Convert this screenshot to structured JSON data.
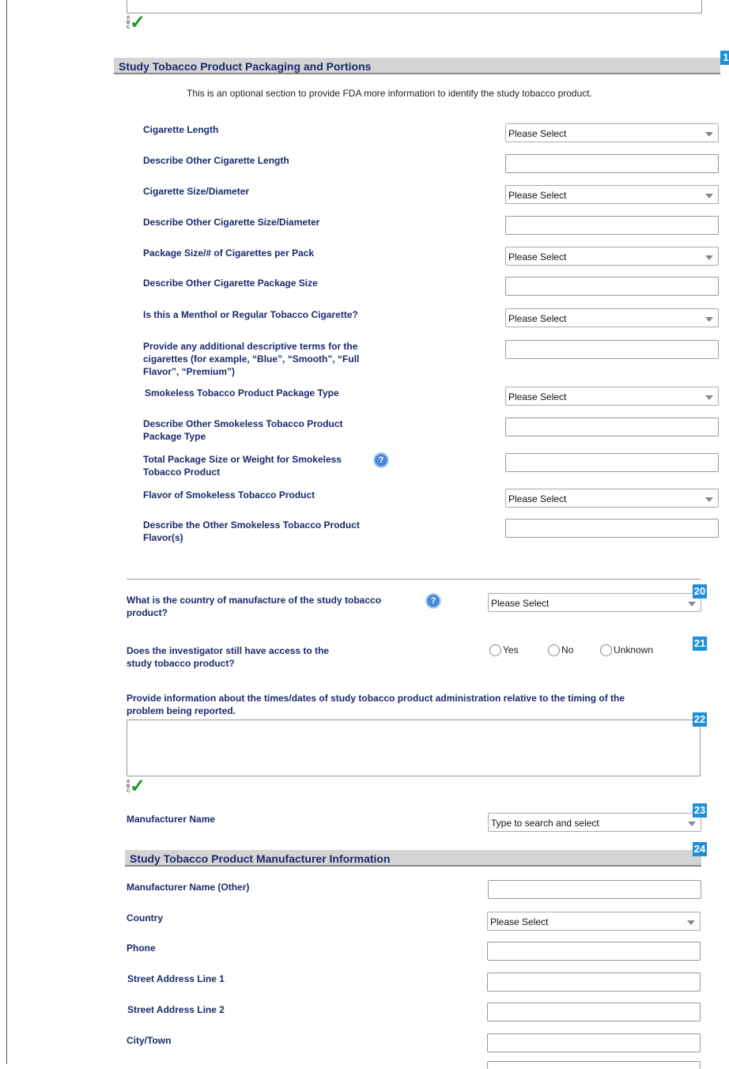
{
  "section1": {
    "title": "Study Tobacco Product Packaging and Portions",
    "number": "1",
    "intro": "This is an optional section to provide FDA more information to identify the study tobacco product."
  },
  "fields": {
    "cig_length": {
      "label": "Cigarette Length",
      "value": "Please Select"
    },
    "cig_length_other": {
      "label": "Describe Other Cigarette Length",
      "value": ""
    },
    "cig_size": {
      "label": "Cigarette Size/Diameter",
      "value": "Please Select"
    },
    "cig_size_other": {
      "label": "Describe Other Cigarette Size/Diameter",
      "value": ""
    },
    "pack_size": {
      "label": "Package Size/# of Cigarettes per Pack",
      "value": "Please Select"
    },
    "pack_size_other": {
      "label": "Describe Other Cigarette Package Size",
      "value": ""
    },
    "menthol": {
      "label": "Is this a Menthol or Regular Tobacco Cigarette?",
      "value": "Please Select"
    },
    "descriptive_terms": {
      "label_line1": "Provide any additional descriptive terms for the",
      "label_line2": "cigarettes (for example, “Blue”, “Smooth”, “Full",
      "label_line3": "Flavor”, “Premium”)",
      "value": ""
    },
    "smokeless_pkg": {
      "label": "Smokeless Tobacco Product Package Type",
      "value": "Please Select"
    },
    "smokeless_pkg_other": {
      "label_line1": "Describe Other Smokeless Tobacco Product",
      "label_line2": "Package Type",
      "value": ""
    },
    "smokeless_weight": {
      "label_line1": "Total Package Size or Weight for Smokeless",
      "label_line2": "Tobacco Product",
      "value": ""
    },
    "smokeless_flavor": {
      "label": "Flavor of Smokeless Tobacco Product",
      "value": "Please Select"
    },
    "smokeless_flavor_other": {
      "label_line1": "Describe the Other Smokeless Tobacco Product",
      "label_line2": "Flavor(s)",
      "value": ""
    }
  },
  "q20": {
    "number": "20",
    "label_line1": "What is the country of manufacture of the study tobacco",
    "label_line2": "product?",
    "value": "Please Select"
  },
  "q21": {
    "number": "21",
    "label_line1": "Does the investigator still have access to the",
    "label_line2": "study tobacco product?",
    "options": [
      "Yes",
      "No",
      "Unknown"
    ]
  },
  "q22": {
    "number": "22",
    "label_line1": "Provide information about the times/dates of study tobacco product administration relative to the timing of the",
    "label_line2": "problem being reported.",
    "value": ""
  },
  "q23": {
    "number": "23",
    "label": "Manufacturer Name",
    "placeholder": "Type to search and select"
  },
  "section24": {
    "number": "24",
    "title": "Study Tobacco Product Manufacturer Information",
    "fields": {
      "mfr_other": {
        "label": "Manufacturer Name (Other)",
        "value": ""
      },
      "country": {
        "label": "Country",
        "value": "Please Select"
      },
      "phone": {
        "label": "Phone",
        "value": ""
      },
      "street1": {
        "label": "Street Address Line 1",
        "value": ""
      },
      "street2": {
        "label": "Street Address Line 2",
        "value": ""
      },
      "city": {
        "label": "City/Town",
        "value": ""
      }
    }
  },
  "spellcheck": {
    "abc": "ABC"
  },
  "help": {
    "glyph": "?"
  }
}
